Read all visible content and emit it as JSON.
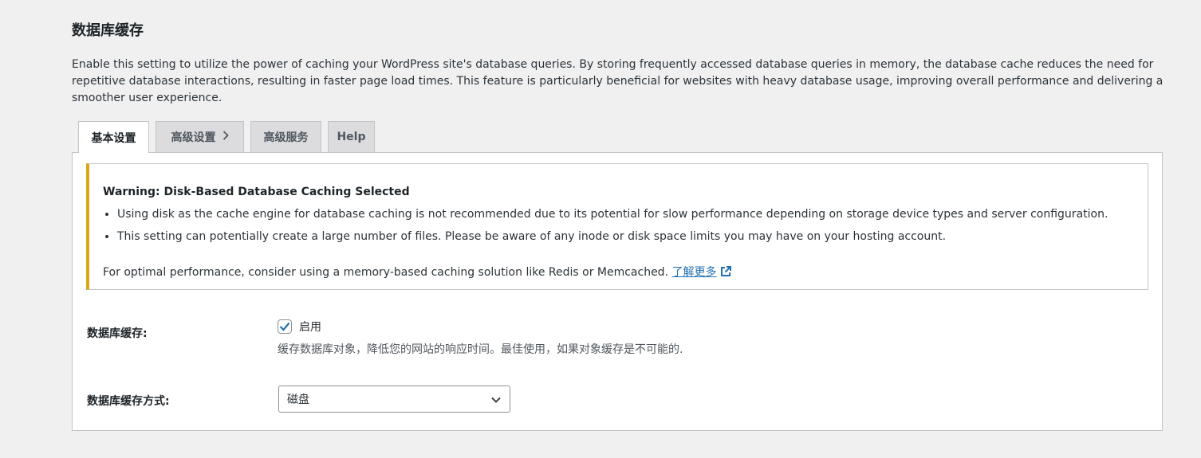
{
  "page": {
    "title": "数据库缓存",
    "description": "Enable this setting to utilize the power of caching your WordPress site's database queries. By storing frequently accessed database queries in memory, the database cache reduces the need for repetitive database interactions, resulting in faster page load times. This feature is particularly beneficial for websites with heavy database usage, improving overall performance and delivering a smoother user experience."
  },
  "tabs": [
    {
      "label": "基本设置",
      "active": true
    },
    {
      "label": "高级设置",
      "has_chevron": true
    },
    {
      "label": "高级服务"
    },
    {
      "label": "Help"
    }
  ],
  "notice": {
    "title": "Warning: Disk-Based Database Caching Selected",
    "bullets": [
      "Using disk as the cache engine for database caching is not recommended due to its potential for slow performance depending on storage device types and server configuration.",
      "This setting can potentially create a large number of files. Please be aware of any inode or disk space limits you may have on your hosting account."
    ],
    "footer_text": "For optimal performance, consider using a memory-based caching solution like Redis or Memcached.",
    "learn_more_label": "了解更多",
    "accent_color": "#dba617",
    "link_color": "#2271b1"
  },
  "settings": {
    "db_cache": {
      "label": "数据库缓存:",
      "checkbox_label": "启用",
      "checked": true,
      "help": "缓存数据库对象，降低您的网站的响应时间。最佳使用，如果对象缓存是不可能的."
    },
    "db_cache_method": {
      "label": "数据库缓存方式:",
      "selected": "磁盘"
    }
  },
  "icons": {
    "tab_chevron": "chevron-right-icon",
    "external_link": "external-link-icon",
    "checkbox_check": "check-icon",
    "select_arrow": "chevron-down-icon"
  }
}
